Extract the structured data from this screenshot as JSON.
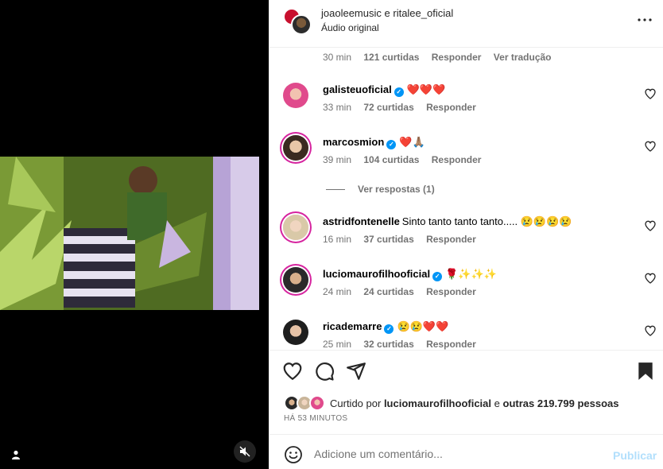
{
  "post": {
    "authors": [
      "joaoleemusic",
      "ritalee_oficial"
    ],
    "author_separator": "e",
    "audio": "Áudio original"
  },
  "top_meta": {
    "time": "30 min",
    "likes": "121 curtidas",
    "reply": "Responder",
    "translate": "Ver tradução"
  },
  "comments": [
    {
      "user": "galisteuoficial",
      "verified": true,
      "text": "❤️❤️❤️",
      "time": "33 min",
      "likes": "72 curtidas",
      "reply": "Responder"
    },
    {
      "user": "marcosmion",
      "verified": true,
      "text": "❤️🙏🏽",
      "time": "39 min",
      "likes": "104 curtidas",
      "reply": "Responder"
    },
    {
      "user": "astridfontenelle",
      "verified": false,
      "text": "Sinto tanto tanto tanto..... 😢😢😢😢",
      "time": "16 min",
      "likes": "37 curtidas",
      "reply": "Responder"
    },
    {
      "user": "luciomaurofilhooficial",
      "verified": true,
      "text": "🌹✨✨✨",
      "time": "24 min",
      "likes": "24 curtidas",
      "reply": "Responder"
    },
    {
      "user": "ricademarre",
      "verified": true,
      "text": "😢😢❤️❤️",
      "time": "25 min",
      "likes": "32 curtidas",
      "reply": "Responder"
    }
  ],
  "view_replies": "Ver respostas (1)",
  "likes_summary": {
    "prefix": "Curtido por",
    "user": "luciomaurofilhooficial",
    "connector": "e",
    "others": "outras 219.799 pessoas"
  },
  "time_ago": "HÁ 53 MINUTOS",
  "add_comment": {
    "placeholder": "Adicione um comentário...",
    "publish": "Publicar"
  },
  "colors": {
    "verified": "#0095f6",
    "publish_disabled": "#b2dffc",
    "secondary_text": "#737373",
    "story_ring": "#d6249f"
  },
  "icons": {
    "like": "heart-icon",
    "comment": "comment-icon",
    "share": "send-icon",
    "save": "bookmark-icon",
    "more": "more-icon",
    "mute": "speaker-muted-icon",
    "user_tag": "user-icon",
    "emoji": "smiley-icon"
  }
}
